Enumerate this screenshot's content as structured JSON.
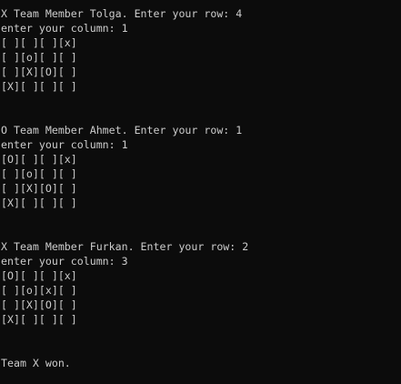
{
  "colors": {
    "background": "#0c0c0c",
    "text": "#cccccc"
  },
  "console": {
    "lines": [
      "X Team Member Tolga. Enter your row: 4",
      "enter your column: 1",
      "[ ][ ][ ][x]",
      "[ ][o][ ][ ]",
      "[ ][X][O][ ]",
      "[X][ ][ ][ ]",
      "",
      "",
      "O Team Member Ahmet. Enter your row: 1",
      "enter your column: 1",
      "[O][ ][ ][x]",
      "[ ][o][ ][ ]",
      "[ ][X][O][ ]",
      "[X][ ][ ][ ]",
      "",
      "",
      "X Team Member Furkan. Enter your row: 2",
      "enter your column: 3",
      "[O][ ][ ][x]",
      "[ ][o][x][ ]",
      "[ ][X][O][ ]",
      "[X][ ][ ][ ]",
      "",
      "",
      "Team X won."
    ]
  }
}
